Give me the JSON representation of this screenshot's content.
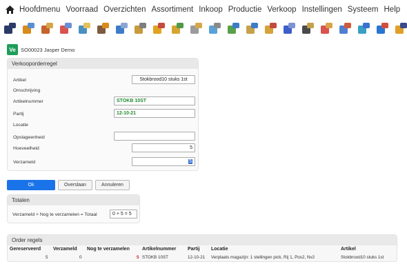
{
  "menu": {
    "items": [
      "Hoofdmenu",
      "Voorraad",
      "Overzichten",
      "Assortiment",
      "Inkoop",
      "Productie",
      "Verkoop",
      "Instellingen",
      "Systeem",
      "Help"
    ]
  },
  "toolbar": {
    "icons": [
      {
        "name": "database-icon",
        "c1": "#2b3a67",
        "c2": "#2b3a67"
      },
      {
        "name": "folder-icon",
        "c1": "#d98b1a",
        "c2": "#5a8fd1"
      },
      {
        "name": "truck-icon",
        "c1": "#c5632c",
        "c2": "#d6a64a"
      },
      {
        "name": "boxes-icon",
        "c1": "#d9534f",
        "c2": "#6a8fd6"
      },
      {
        "name": "clipboard-icon",
        "c1": "#4a90c2",
        "c2": "#e2c25b"
      },
      {
        "name": "grid-icon",
        "c1": "#7d5b3e",
        "c2": "#d98b1a"
      },
      {
        "name": "cube-icon",
        "c1": "#3d7cc9",
        "c2": "#8aa5d1"
      },
      {
        "name": "pen-icon",
        "c1": "#c59b3d",
        "c2": "#7e7e7e"
      },
      {
        "name": "package-icon",
        "c1": "#e2a21f",
        "c2": "#c44b3f"
      },
      {
        "name": "box-icon",
        "c1": "#d4a530",
        "c2": "#4f9a4a"
      },
      {
        "name": "search-box-icon",
        "c1": "#9b9b9b",
        "c2": "#d6a64a"
      },
      {
        "name": "search-list-icon",
        "c1": "#5aa2d9",
        "c2": "#8a8a8a"
      },
      {
        "name": "gear-icon",
        "c1": "#5aa04a",
        "c2": "#3d7cc9"
      },
      {
        "name": "document-icon",
        "c1": "#c7a14a",
        "c2": "#3d7cc9"
      },
      {
        "name": "orders-icon",
        "c1": "#d7a23c",
        "c2": "#c24b3f"
      },
      {
        "name": "cart-icon",
        "c1": "#3d5fc9",
        "c2": "#7e93d6"
      },
      {
        "name": "receipt-icon",
        "c1": "#4a4a4a",
        "c2": "#c2a24a"
      },
      {
        "name": "invoice-icon",
        "c1": "#d9534f",
        "c2": "#d9a24a"
      },
      {
        "name": "list-icon",
        "c1": "#4f7fd1",
        "c2": "#cf5a3c"
      },
      {
        "name": "shipment-icon",
        "c1": "#3aa0c2",
        "c2": "#3c6fd1"
      },
      {
        "name": "basket-icon",
        "c1": "#2a74d2",
        "c2": "#d24f3a"
      },
      {
        "name": "user-icon",
        "c1": "#e0a028",
        "c2": "#3a4a8a"
      }
    ]
  },
  "app": {
    "badge": "Ve",
    "title": "SO00023 Jasper Demo"
  },
  "form": {
    "title": "Verkooporderregel",
    "fields": {
      "artikel_label": "Artikel",
      "artikel_value": "Stokbrood10 stuks 1st",
      "omschrijving_label": "Omschrijving",
      "artikelnummer_label": "Artikelnummer",
      "artikelnummer_value": "STOKB 10ST",
      "partij_label": "Partij",
      "partij_value": "12-10-21",
      "locatie_label": "Locatie",
      "opslageenheid_label": "Opslageenheid",
      "opslageenheid_value": "",
      "hoeveelheid_label": "Hoeveelheid",
      "hoeveelheid_value": "5",
      "verzameld_label": "Verzameld",
      "verzameld_value": "5"
    }
  },
  "buttons": {
    "ok": "Ok",
    "overslaan": "Overslaan",
    "annuleren": "Annuleren"
  },
  "totals": {
    "title": "Totalen",
    "label": "Verzameld + Nog te verzamelen = Totaal",
    "value": "0 + 5 = 5"
  },
  "orders": {
    "title": "Order regels",
    "columns": [
      "Gereserveerd",
      "Verzameld",
      "Nog te verzamelen",
      "Artikelnummer",
      "Partij",
      "Locatie",
      "Artikel"
    ],
    "rows": [
      [
        "5",
        "0",
        "5",
        "STOKB 10ST",
        "12-10-21",
        "Verplaats magazijn: 1 stellingen pick, Rij 1, Pos2, Nv2",
        "Stokbrood10 stuks 1st"
      ]
    ],
    "highlight_color": "#d62020"
  },
  "colors": {
    "accent": "#1a73e8",
    "badge": "#1e9e5a",
    "green_text": "#1f8a2f"
  }
}
